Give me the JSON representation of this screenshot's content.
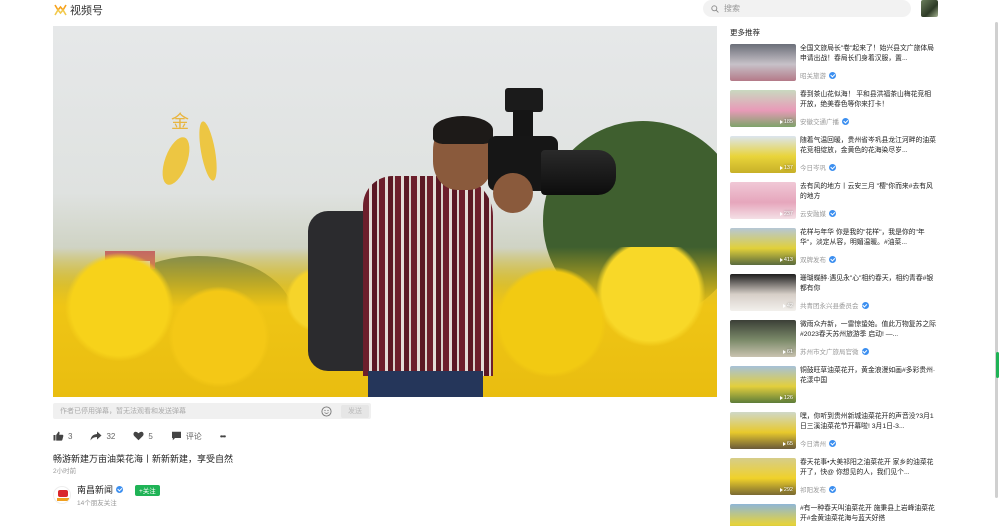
{
  "header": {
    "logo_text": "视频号",
    "search_placeholder": "搜索"
  },
  "player": {
    "calligraphy": "金"
  },
  "comment": {
    "placeholder": "作者已停用弹幕，暂无法观看和发送弹幕",
    "send_label": "发送"
  },
  "actions": {
    "likes": "3",
    "shares": "32",
    "favorites": "5",
    "comment_label": "评论",
    "more_label": "•••"
  },
  "video": {
    "title": "畅游新建万亩油菜花海丨新新新建，享受自然",
    "time": "2小时前"
  },
  "author": {
    "name": "南昌新闻",
    "followers": "14个朋友关注",
    "follow_label": "+关注"
  },
  "sidebar": {
    "title": "更多推荐",
    "items": [
      {
        "title": "全国文旅局长\"卷\"起来了！始兴县文广旅体局申请出战！春局长们身着汉服，置...",
        "source": "昭关旅游",
        "count": "",
        "verified": true,
        "thumb": [
          "#6b6f79",
          "#c7c1c8",
          "#b47a88"
        ]
      },
      {
        "title": "春到茶山花似海！ 平和县洪福茶山梅花竞相开放，绝美春色等你来打卡！",
        "source": "安徽交通广播",
        "count": "185",
        "verified": true,
        "thumb": [
          "#c9d9c0",
          "#e89ab8",
          "#7ea36a"
        ]
      },
      {
        "title": "随着气温回暖，贵州省岑巩县龙江河畔的油菜花竞相绽放，金黄色的花海染尽岁...",
        "source": "今日岑巩",
        "count": "137",
        "verified": true,
        "thumb": [
          "#dbe5ef",
          "#e9d43a",
          "#c7b028"
        ]
      },
      {
        "title": "去有风的地方丨云安三月 \"樱\"你而来#去有风的地方",
        "source": "云安融媒",
        "count": "237",
        "verified": true,
        "thumb": [
          "#f0c8d6",
          "#e6a6bc",
          "#f4e0e6"
        ]
      },
      {
        "title": "花样与年华 你是我的\"花样\"，我是你的\"年华\"，淡定从容，明媚温暖。#油菜...",
        "source": "双牌发布",
        "count": "413",
        "verified": true,
        "thumb": [
          "#b6c7d6",
          "#e1d03a",
          "#5a6b3e"
        ]
      },
      {
        "title": "珊瑚蝶醉·遇见永\"心\"相约春天，相约青春#银都有你",
        "source": "共青团永兴县委员会",
        "count": "42",
        "verified": true,
        "thumb": [
          "#1e1e1e",
          "#d7cfc8",
          "#f2f0ec"
        ]
      },
      {
        "title": "微雨众卉新，一雷惊蛰始。值此万物复苏之际 #2023春天苏州旅游季 启动! —...",
        "source": "苏州市文广旅局官微",
        "count": "61",
        "verified": true,
        "thumb": [
          "#3b3f37",
          "#7c8b6a",
          "#c9c3b0"
        ]
      },
      {
        "title": "铜鼓旺草油菜花开，黄金浪漫如画#多彩贵州·花漾中国",
        "source": "",
        "count": "126",
        "verified": false,
        "thumb": [
          "#a7c1d8",
          "#e3cf3d",
          "#5d7d3a"
        ]
      },
      {
        "title": "嘿，你听到贵州新城油菜花开的声音没?3月1日三溪油菜花节开幕啦! 3月1日-3...",
        "source": "今日清州",
        "count": "65",
        "verified": true,
        "thumb": [
          "#cfd8c8",
          "#e8c92c",
          "#6a5a3a"
        ]
      },
      {
        "title": "春天花事•大美祁阳之油菜花开 家乡的油菜花开了，快@ 你想见的人，我们见个...",
        "source": "祁阳发布",
        "count": "292",
        "verified": true,
        "thumb": [
          "#d6cd8a",
          "#f0d12a",
          "#7a6a32"
        ]
      },
      {
        "title": "#有一种春天叫油菜花开 施秉县上岩峰油菜花开#金黄油菜花海与蓝天好搭",
        "source": "",
        "count": "",
        "verified": false,
        "thumb": [
          "#8fb6d6",
          "#e6d33c",
          "#6a8a3a"
        ]
      }
    ]
  }
}
